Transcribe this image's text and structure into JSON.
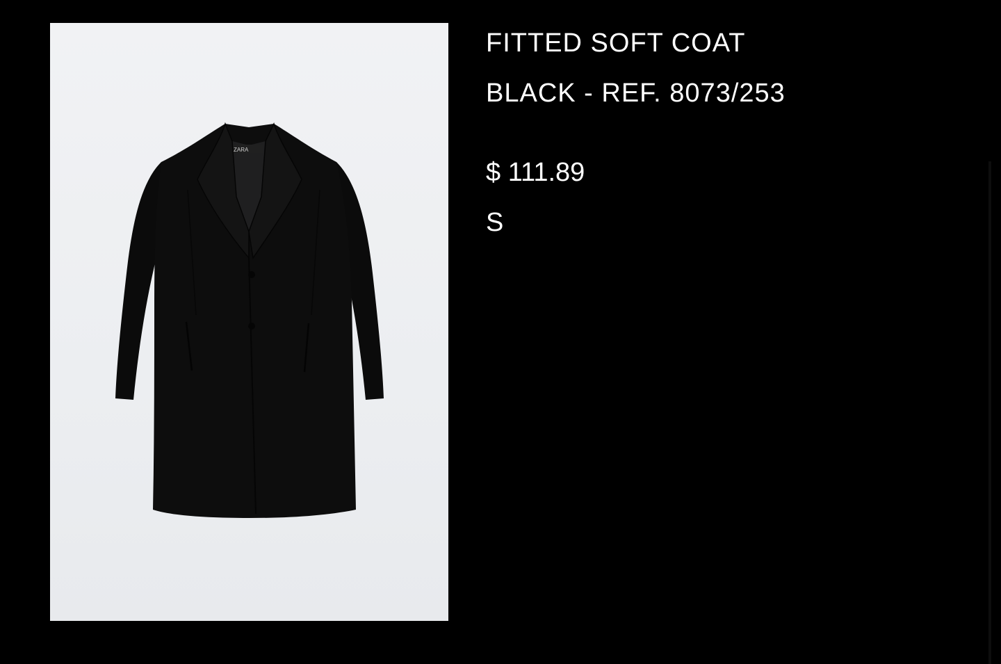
{
  "product": {
    "name": "FITTED SOFT COAT",
    "color_ref": "BLACK - REF. 8073/253",
    "price": "$ 111.89",
    "size": "S",
    "image_label": "ZARA"
  },
  "colors": {
    "background": "#000000",
    "text": "#ffffff",
    "image_backdrop": "#eef0f2",
    "coat": "#0a0a0a"
  }
}
